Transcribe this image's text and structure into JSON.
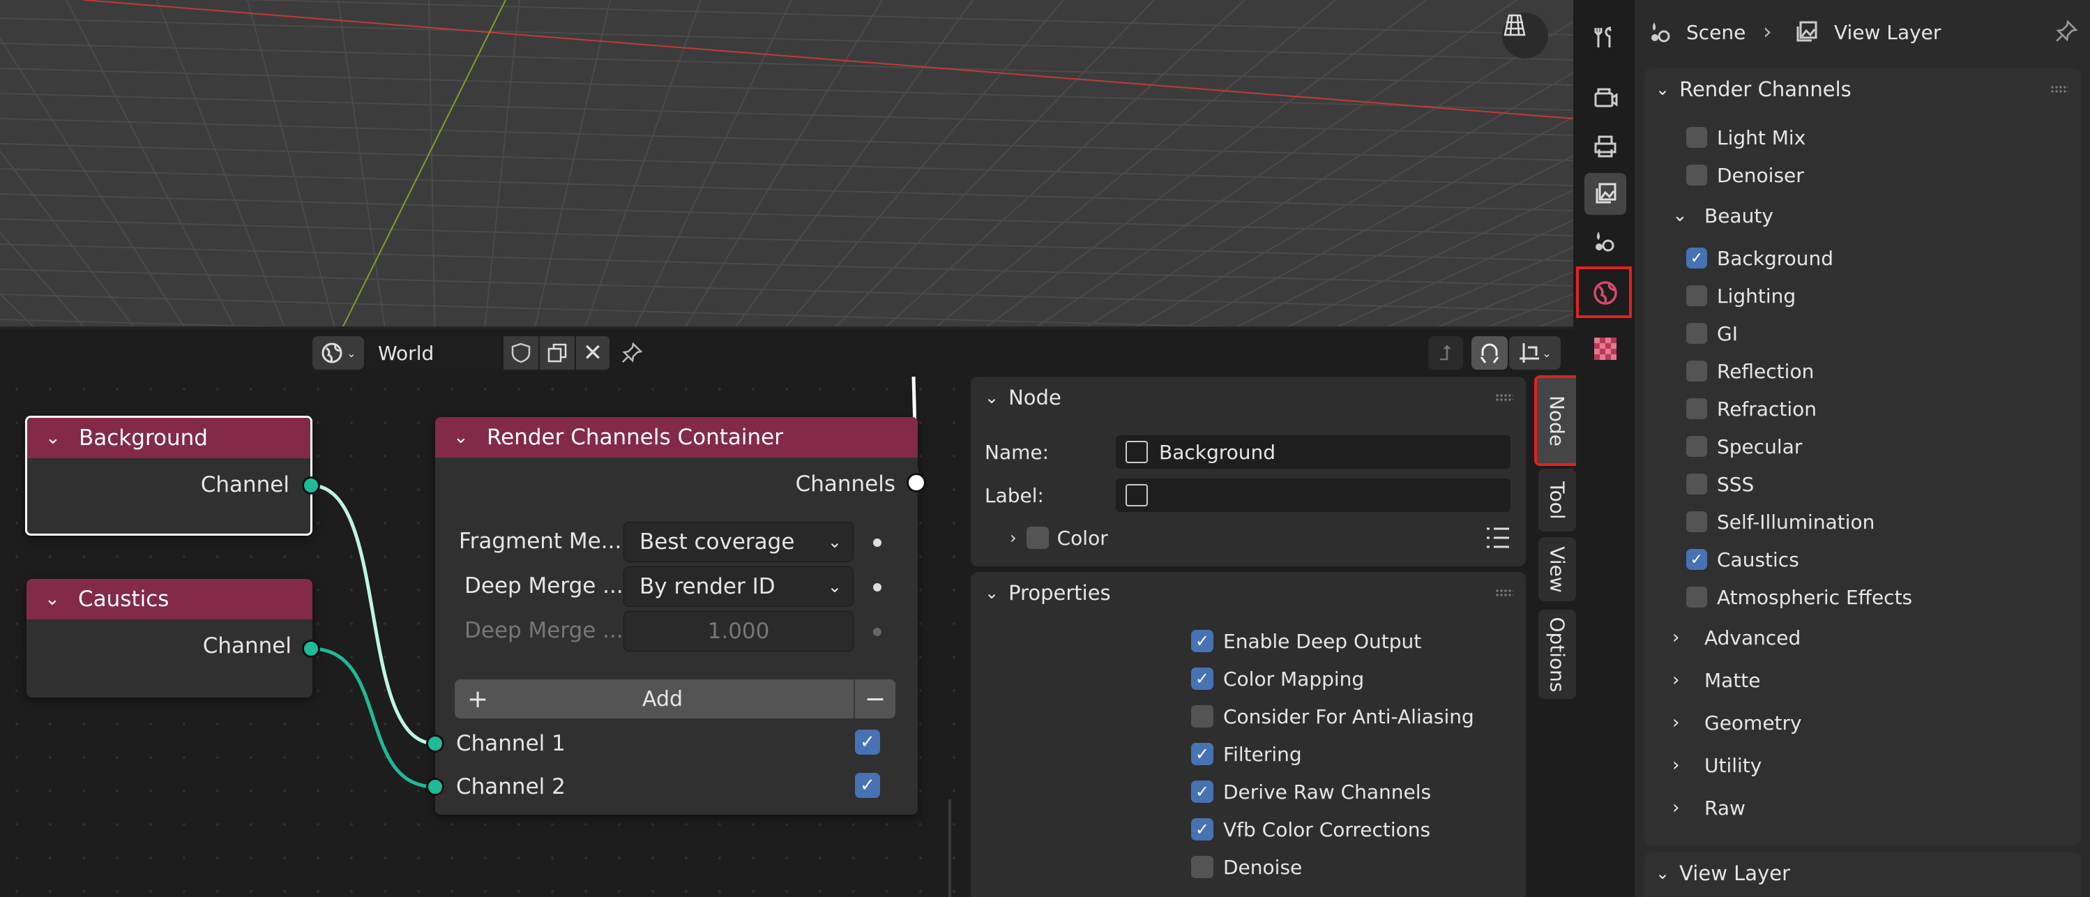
{
  "node_editor": {
    "header": {
      "datablock_name": "World"
    },
    "sidebar_tabs": [
      "Node",
      "Tool",
      "View",
      "Options"
    ],
    "nodes": {
      "background": {
        "title": "Background",
        "output": "Channel"
      },
      "caustics": {
        "title": "Caustics",
        "output": "Channel"
      },
      "container": {
        "title": "Render Channels Container",
        "output": "Channels",
        "fields": [
          {
            "label": "Fragment Me...",
            "value": "Best coverage"
          },
          {
            "label": "Deep Merge ...",
            "value": "By render ID"
          },
          {
            "label": "Deep Merge ...",
            "value": "1.000"
          }
        ],
        "add_label": "Add",
        "inputs": [
          "Channel 1",
          "Channel 2"
        ]
      }
    },
    "node_panel": {
      "title": "Node",
      "name_label": "Name:",
      "name_value": "Background",
      "label_label": "Label:",
      "label_value": "",
      "color_label": "Color"
    },
    "properties_panel": {
      "title": "Properties",
      "options": [
        {
          "label": "Enable Deep Output",
          "checked": true
        },
        {
          "label": "Color Mapping",
          "checked": true
        },
        {
          "label": "Consider For Anti-Aliasing",
          "checked": false
        },
        {
          "label": "Filtering",
          "checked": true
        },
        {
          "label": "Derive Raw Channels",
          "checked": true
        },
        {
          "label": "Vfb Color Corrections",
          "checked": true
        },
        {
          "label": "Denoise",
          "checked": false
        }
      ]
    }
  },
  "properties": {
    "breadcrumb": [
      "Scene",
      "View Layer"
    ],
    "render_channels": {
      "title": "Render Channels",
      "top_items": [
        {
          "label": "Light Mix",
          "checked": false
        },
        {
          "label": "Denoiser",
          "checked": false
        }
      ],
      "beauty": {
        "title": "Beauty",
        "items": [
          {
            "label": "Background",
            "checked": true
          },
          {
            "label": "Lighting",
            "checked": false
          },
          {
            "label": "GI",
            "checked": false
          },
          {
            "label": "Reflection",
            "checked": false
          },
          {
            "label": "Refraction",
            "checked": false
          },
          {
            "label": "Specular",
            "checked": false
          },
          {
            "label": "SSS",
            "checked": false
          },
          {
            "label": "Self-Illumination",
            "checked": false
          },
          {
            "label": "Caustics",
            "checked": true
          },
          {
            "label": "Atmospheric Effects",
            "checked": false
          }
        ]
      },
      "groups": [
        "Advanced",
        "Matte",
        "Geometry",
        "Utility",
        "Raw"
      ]
    },
    "view_layer": {
      "title": "View Layer"
    }
  },
  "colors": {
    "accent": "#4772b3",
    "node_header": "#832a48",
    "socket": "#1fba97",
    "highlight": "#e32020"
  }
}
